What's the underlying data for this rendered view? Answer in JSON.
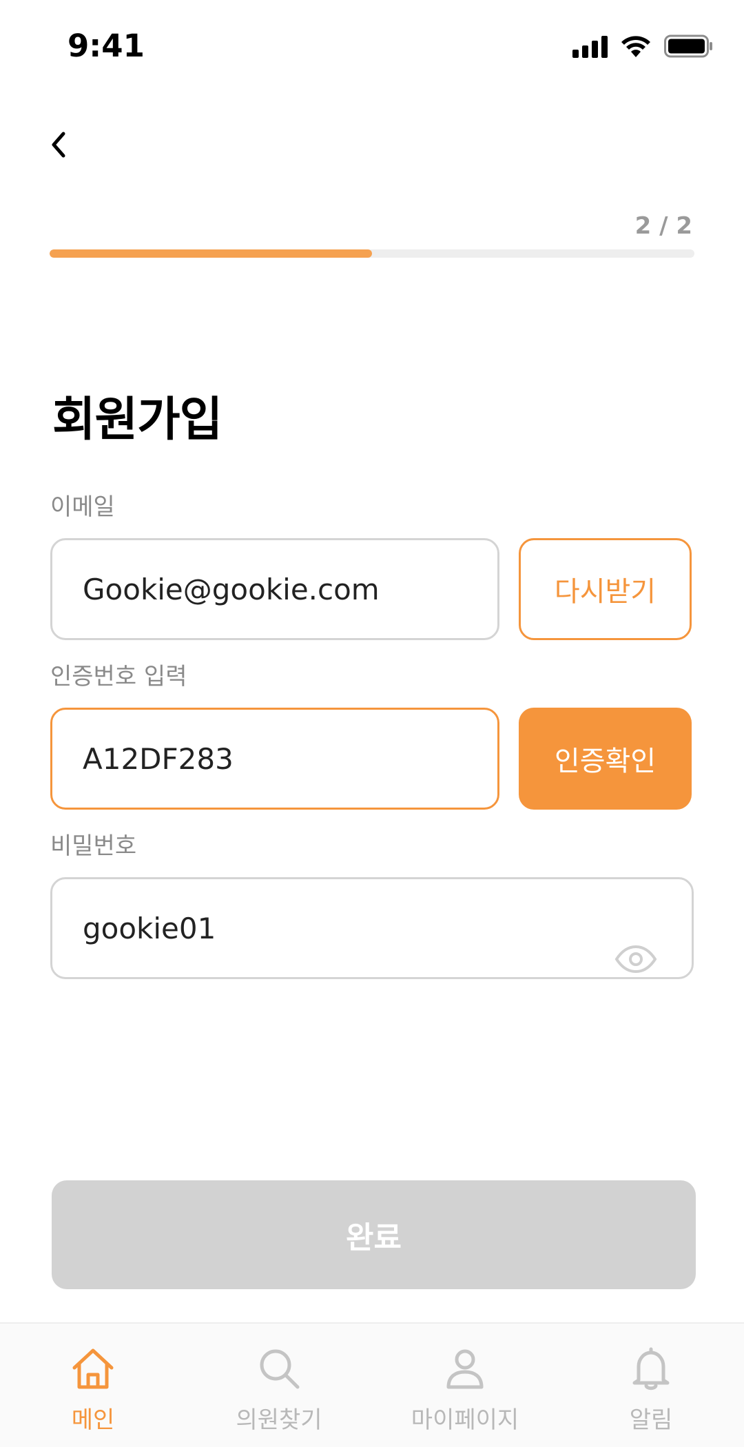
{
  "status_bar": {
    "time": "9:41",
    "icons": [
      "signal-icon",
      "wifi-icon",
      "battery-icon"
    ]
  },
  "header": {
    "back_icon": "chevron-left-icon",
    "step": "2 / 2",
    "progress": 0.5
  },
  "title": "회원가입",
  "form": {
    "email": {
      "label": "이메일",
      "value": "Gookie@gookie.com",
      "resend_label": "다시받기"
    },
    "code": {
      "label": "인증번호 입력",
      "value": "A12DF283",
      "confirm_label": "인증확인"
    },
    "password": {
      "label": "비밀번호",
      "value": "gookie01",
      "toggle_icon": "eye-icon"
    },
    "submit_label": "완료"
  },
  "bottom_nav": {
    "items": [
      {
        "label": "메인",
        "icon": "home-icon",
        "active": true
      },
      {
        "label": "의원찾기",
        "icon": "search-icon",
        "active": false
      },
      {
        "label": "마이페이지",
        "icon": "person-icon",
        "active": false
      },
      {
        "label": "알림",
        "icon": "bell-icon",
        "active": false
      }
    ]
  },
  "colors": {
    "accent": "#f5953c",
    "progress": "#f5a150",
    "disabled": "#d2d2d2"
  }
}
